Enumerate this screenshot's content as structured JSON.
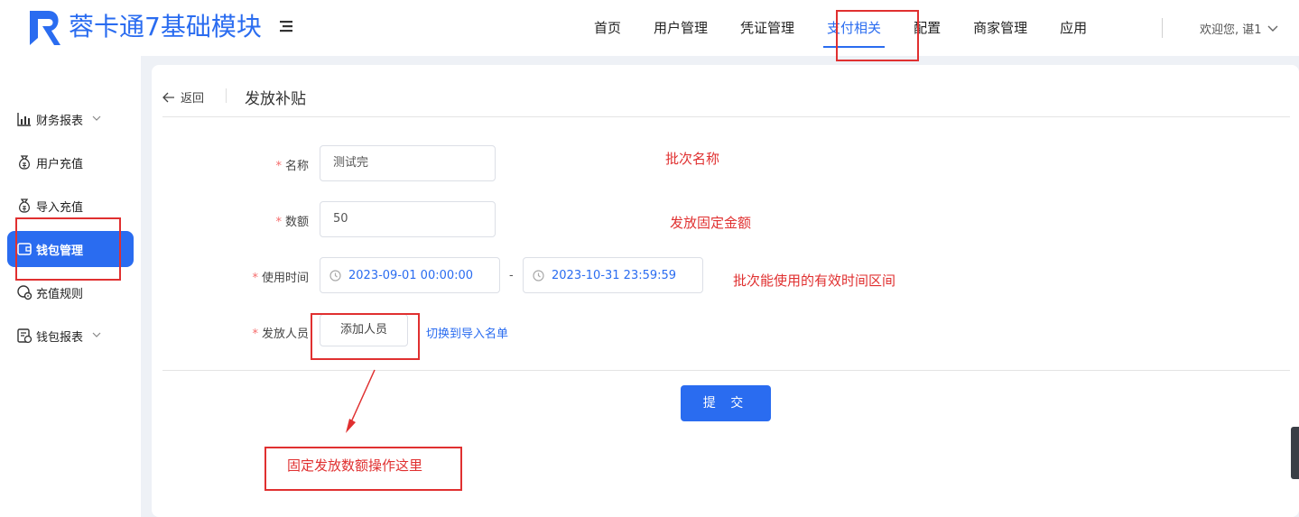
{
  "header": {
    "title": "蓉卡通7基础模块",
    "nav": [
      {
        "label": "首页"
      },
      {
        "label": "用户管理"
      },
      {
        "label": "凭证管理"
      },
      {
        "label": "支付相关",
        "active": true
      },
      {
        "label": "配置"
      },
      {
        "label": "商家管理"
      },
      {
        "label": "应用"
      }
    ],
    "user_greeting": "欢迎您, 谌1"
  },
  "sidebar": {
    "items": [
      {
        "label": "财务报表",
        "icon": "bar-chart-icon",
        "has_caret": true
      },
      {
        "label": "用户充值",
        "icon": "money-bag-icon"
      },
      {
        "label": "导入充值",
        "icon": "money-bag-icon"
      },
      {
        "label": "钱包管理",
        "icon": "wallet-icon",
        "active": true
      },
      {
        "label": "充值规则",
        "icon": "rule-icon"
      },
      {
        "label": "钱包报表",
        "icon": "report-icon",
        "has_caret": true
      }
    ]
  },
  "page": {
    "back_label": "返回",
    "title": "发放补贴"
  },
  "form": {
    "name_label": "名称",
    "name_value": "测试完",
    "amount_label": "数额",
    "amount_value": "50",
    "time_label": "使用时间",
    "start_time": "2023-09-01 00:00:00",
    "range_separator": "-",
    "end_time": "2023-10-31 23:59:59",
    "people_label": "发放人员",
    "add_people_button": "添加人员",
    "switch_import_link": "切换到导入名单",
    "submit_button": "提 交"
  },
  "annotations": {
    "batch_name": "批次名称",
    "fixed_amount": "发放固定金额",
    "valid_range": "批次能使用的有效时间区间",
    "fixed_operation": "固定发放数额操作这里"
  },
  "colors": {
    "accent": "#2a6cf0",
    "annotation_red": "#e03030",
    "required_star": "#f56c6c"
  }
}
